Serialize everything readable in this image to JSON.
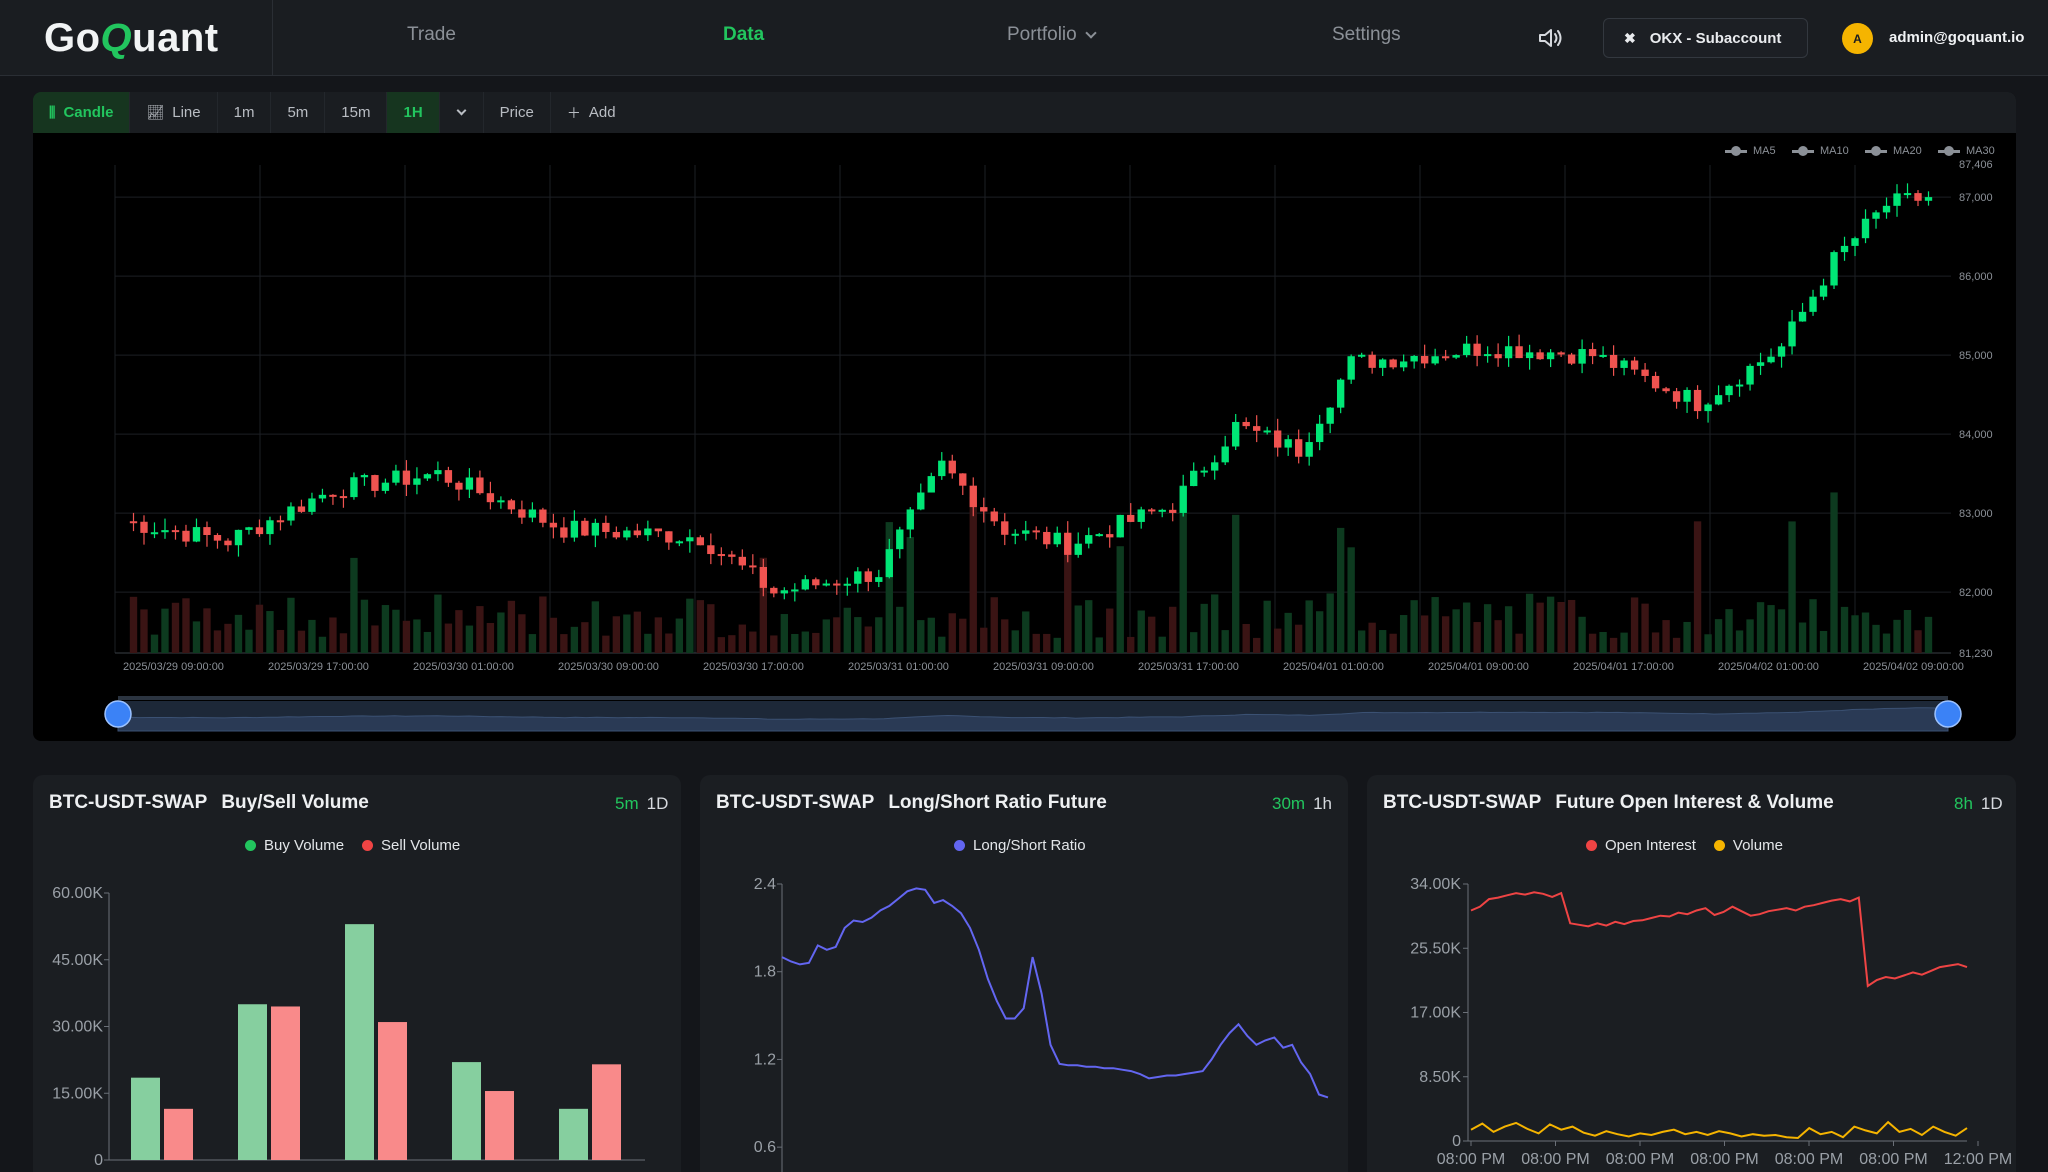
{
  "nav": {
    "logo_prefix": "Go",
    "logo_q": "Q",
    "logo_suffix": "uant",
    "items": [
      "Trade",
      "Data",
      "Portfolio",
      "Settings"
    ],
    "active": "Data",
    "account_label": "OKX - Subaccount",
    "avatar_initial": "A",
    "email": "admin@goquant.io"
  },
  "toolbar": {
    "candle": "Candle",
    "line": "Line",
    "intervals": [
      "1m",
      "5m",
      "15m",
      "1H"
    ],
    "active_interval": "1H",
    "price": "Price",
    "add": "Add"
  },
  "main_chart": {
    "ma_legend": [
      "MA5",
      "MA10",
      "MA20",
      "MA30"
    ],
    "price_ticks": [
      "87,406",
      "87,000",
      "86,000",
      "85,000",
      "84,000",
      "83,000",
      "82,000",
      "81,230"
    ],
    "time_ticks": [
      "2025/03/29 09:00:00",
      "2025/03/29 17:00:00",
      "2025/03/30 01:00:00",
      "2025/03/30 09:00:00",
      "2025/03/30 17:00:00",
      "2025/03/31 01:00:00",
      "2025/03/31 09:00:00",
      "2025/03/31 17:00:00",
      "2025/04/01 01:00:00",
      "2025/04/01 09:00:00",
      "2025/04/01 17:00:00",
      "2025/04/02 01:00:00",
      "2025/04/02 09:00:00"
    ],
    "up_color": "#00e676",
    "down_color": "#ef5350"
  },
  "chart_data": [
    {
      "type": "bar",
      "title": "BTC-USDT-SWAP Buy/Sell Volume",
      "categories": [
        "",
        "",
        "",
        "",
        ""
      ],
      "series": [
        {
          "name": "Buy Volume",
          "values": [
            18500,
            35000,
            53000,
            22000,
            11500
          ],
          "color": "#86cf9f"
        },
        {
          "name": "Sell Volume",
          "values": [
            11500,
            34500,
            31000,
            15500,
            21500
          ],
          "color": "#f98a8a"
        }
      ],
      "ylim": [
        0,
        60000
      ],
      "yticks": [
        "60.00K",
        "45.00K",
        "30.00K",
        "15.00K",
        "0"
      ]
    },
    {
      "type": "line",
      "title": "BTC-USDT-SWAP Long/Short Ratio Future",
      "series": [
        {
          "name": "Long/Short Ratio",
          "color": "#6366f1",
          "values": [
            1.9,
            1.87,
            1.85,
            1.86,
            1.98,
            1.95,
            1.97,
            2.1,
            2.15,
            2.14,
            2.17,
            2.22,
            2.25,
            2.3,
            2.35,
            2.37,
            2.36,
            2.27,
            2.29,
            2.25,
            2.2,
            2.1,
            1.95,
            1.75,
            1.6,
            1.48,
            1.48,
            1.55,
            1.9,
            1.65,
            1.3,
            1.17,
            1.16,
            1.16,
            1.15,
            1.15,
            1.14,
            1.14,
            1.13,
            1.12,
            1.1,
            1.07,
            1.08,
            1.09,
            1.09,
            1.1,
            1.11,
            1.12,
            1.2,
            1.3,
            1.38,
            1.44,
            1.36,
            1.3,
            1.33,
            1.35,
            1.28,
            1.3,
            1.18,
            1.1,
            0.96,
            0.94
          ]
        }
      ],
      "ylim": [
        0.3,
        2.4
      ],
      "yticks": [
        "2.4",
        "1.8",
        "1.2",
        "0.6"
      ]
    },
    {
      "type": "line",
      "title": "BTC-USDT-SWAP Future Open Interest & Volume",
      "x_ticks": [
        "08:00 PM",
        "08:00 PM",
        "08:00 PM",
        "08:00 PM",
        "08:00 PM",
        "08:00 PM",
        "12:00 PM"
      ],
      "series": [
        {
          "name": "Open Interest",
          "color": "#ef4444",
          "values": [
            30500,
            31000,
            32000,
            32200,
            32500,
            32800,
            32600,
            32900,
            32700,
            32300,
            32800,
            28800,
            28600,
            28400,
            28800,
            28500,
            29000,
            28700,
            29100,
            29200,
            29500,
            29800,
            29700,
            30200,
            30000,
            30500,
            30800,
            29900,
            30300,
            31000,
            30400,
            29800,
            30000,
            30400,
            30600,
            30800,
            30500,
            31000,
            31200,
            31500,
            31800,
            32000,
            31700,
            32200,
            20500,
            21300,
            21700,
            21500,
            21900,
            22300,
            22000,
            22500,
            23000,
            23200,
            23400,
            23000
          ]
        },
        {
          "name": "Volume",
          "color": "#f5b400",
          "values": [
            1500,
            2300,
            1200,
            1900,
            2400,
            1600,
            1000,
            2200,
            1500,
            1900,
            1100,
            700,
            1300,
            900,
            600,
            1000,
            800,
            1200,
            1500,
            900,
            1200,
            800,
            1300,
            1000,
            600,
            900,
            700,
            800,
            500,
            400,
            1700,
            900,
            1200,
            500,
            1900,
            1400,
            1000,
            2500,
            1200,
            1600,
            800,
            1900,
            1200,
            700,
            1700
          ]
        }
      ],
      "ylim": [
        0,
        34000
      ],
      "yticks": [
        "34.00K",
        "25.50K",
        "17.00K",
        "8.50K",
        "0"
      ]
    }
  ],
  "panels": {
    "p1": {
      "symbol": "BTC-USDT-SWAP",
      "name": "Buy/Sell Volume",
      "tf_a": "5m",
      "tf_b": "1D",
      "legend": [
        "Buy Volume",
        "Sell Volume"
      ]
    },
    "p2": {
      "symbol": "BTC-USDT-SWAP",
      "name": "Long/Short Ratio Future",
      "tf_a": "30m",
      "tf_b": "1h",
      "legend": [
        "Long/Short Ratio"
      ]
    },
    "p3": {
      "symbol": "BTC-USDT-SWAP",
      "name": "Future Open Interest & Volume",
      "tf_a": "8h",
      "tf_b": "1D",
      "legend": [
        "Open Interest",
        "Volume"
      ]
    }
  }
}
